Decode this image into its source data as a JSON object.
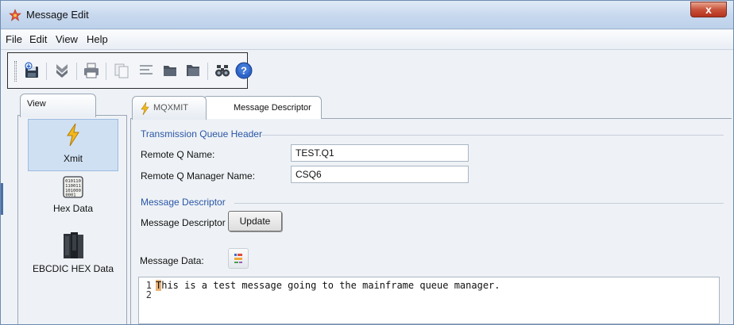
{
  "window": {
    "title": "Message Edit",
    "close_label": "x"
  },
  "menu": {
    "items": [
      "File",
      "Edit",
      "View",
      "Help"
    ]
  },
  "toolbar": {
    "buttons": [
      {
        "icon": "save-down-icon"
      },
      {
        "icon": "down-arrow-icon"
      },
      {
        "icon": "print-icon"
      },
      {
        "icon": "copy-pages-icon"
      },
      {
        "icon": "align-lines-icon"
      },
      {
        "icon": "folder-dark-icon"
      },
      {
        "icon": "folder-dark-2-icon"
      },
      {
        "icon": "binoculars-icon"
      },
      {
        "icon": "help-icon"
      }
    ]
  },
  "left_panel": {
    "tab_label": "View",
    "items": [
      {
        "label": "Xmit",
        "icon": "lightning-icon",
        "selected": true
      },
      {
        "label": "Hex Data",
        "icon": "binary-document-icon",
        "selected": false
      },
      {
        "label": "EBCDIC HEX Data",
        "icon": "mainframe-icon",
        "selected": false
      }
    ]
  },
  "tabs": [
    {
      "label": "MQXMIT",
      "active": true,
      "icon": "lightning-icon"
    },
    {
      "label": "Message Descriptor",
      "active": false
    }
  ],
  "xmit": {
    "group_title": "Transmission Queue Header",
    "remote_q_label": "Remote Q Name:",
    "remote_q_value": "TEST.Q1",
    "remote_qmgr_label": "Remote Q Manager Name:",
    "remote_qmgr_value": "CSQ6",
    "md_group_title": "Message Descriptor",
    "md_label": "Message Descriptor",
    "update_label": "Update",
    "data_label": "Message Data:"
  },
  "editor": {
    "line_numbers": [
      "1",
      "2"
    ],
    "first_char": "T",
    "line1_rest": "his is a test message going to the mainframe queue manager."
  }
}
